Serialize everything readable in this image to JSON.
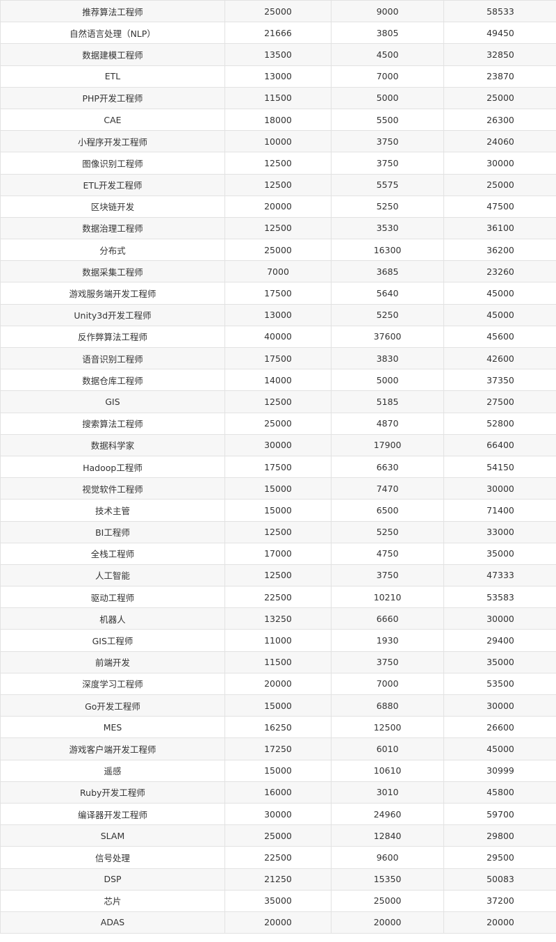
{
  "table": {
    "rows": [
      [
        "推荐算法工程师",
        "25000",
        "9000",
        "58533"
      ],
      [
        "自然语言处理（NLP）",
        "21666",
        "3805",
        "49450"
      ],
      [
        "数据建模工程师",
        "13500",
        "4500",
        "32850"
      ],
      [
        "ETL",
        "13000",
        "7000",
        "23870"
      ],
      [
        "PHP开发工程师",
        "11500",
        "5000",
        "25000"
      ],
      [
        "CAE",
        "18000",
        "5500",
        "26300"
      ],
      [
        "小程序开发工程师",
        "10000",
        "3750",
        "24060"
      ],
      [
        "图像识别工程师",
        "12500",
        "3750",
        "30000"
      ],
      [
        "ETL开发工程师",
        "12500",
        "5575",
        "25000"
      ],
      [
        "区块链开发",
        "20000",
        "5250",
        "47500"
      ],
      [
        "数据治理工程师",
        "12500",
        "3530",
        "36100"
      ],
      [
        "分布式",
        "25000",
        "16300",
        "36200"
      ],
      [
        "数据采集工程师",
        "7000",
        "3685",
        "23260"
      ],
      [
        "游戏服务端开发工程师",
        "17500",
        "5640",
        "45000"
      ],
      [
        "Unity3d开发工程师",
        "13000",
        "5250",
        "45000"
      ],
      [
        "反作弊算法工程师",
        "40000",
        "37600",
        "45600"
      ],
      [
        "语音识别工程师",
        "17500",
        "3830",
        "42600"
      ],
      [
        "数据仓库工程师",
        "14000",
        "5000",
        "37350"
      ],
      [
        "GIS",
        "12500",
        "5185",
        "27500"
      ],
      [
        "搜索算法工程师",
        "25000",
        "4870",
        "52800"
      ],
      [
        "数据科学家",
        "30000",
        "17900",
        "66400"
      ],
      [
        "Hadoop工程师",
        "17500",
        "6630",
        "54150"
      ],
      [
        "视觉软件工程师",
        "15000",
        "7470",
        "30000"
      ],
      [
        "技术主管",
        "15000",
        "6500",
        "71400"
      ],
      [
        "BI工程师",
        "12500",
        "5250",
        "33000"
      ],
      [
        "全栈工程师",
        "17000",
        "4750",
        "35000"
      ],
      [
        "人工智能",
        "12500",
        "3750",
        "47333"
      ],
      [
        "驱动工程师",
        "22500",
        "10210",
        "53583"
      ],
      [
        "机器人",
        "13250",
        "6660",
        "30000"
      ],
      [
        "GIS工程师",
        "11000",
        "1930",
        "29400"
      ],
      [
        "前端开发",
        "11500",
        "3750",
        "35000"
      ],
      [
        "深度学习工程师",
        "20000",
        "7000",
        "53500"
      ],
      [
        "Go开发工程师",
        "15000",
        "6880",
        "30000"
      ],
      [
        "MES",
        "16250",
        "12500",
        "26600"
      ],
      [
        "游戏客户端开发工程师",
        "17250",
        "6010",
        "45000"
      ],
      [
        "遥感",
        "15000",
        "10610",
        "30999"
      ],
      [
        "Ruby开发工程师",
        "16000",
        "3010",
        "45800"
      ],
      [
        "编译器开发工程师",
        "30000",
        "24960",
        "59700"
      ],
      [
        "SLAM",
        "25000",
        "12840",
        "29800"
      ],
      [
        "信号处理",
        "22500",
        "9600",
        "29500"
      ],
      [
        "DSP",
        "21250",
        "15350",
        "50083"
      ],
      [
        "芯片",
        "35000",
        "25000",
        "37200"
      ],
      [
        "ADAS",
        "20000",
        "20000",
        "20000"
      ]
    ]
  }
}
